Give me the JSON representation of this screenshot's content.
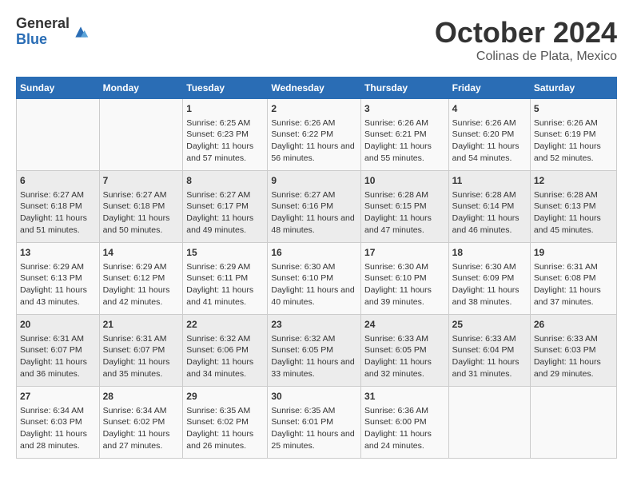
{
  "header": {
    "logo_general": "General",
    "logo_blue": "Blue",
    "month": "October 2024",
    "location": "Colinas de Plata, Mexico"
  },
  "days_of_week": [
    "Sunday",
    "Monday",
    "Tuesday",
    "Wednesday",
    "Thursday",
    "Friday",
    "Saturday"
  ],
  "weeks": [
    [
      {
        "day": "",
        "sunrise": "",
        "sunset": "",
        "daylight": ""
      },
      {
        "day": "",
        "sunrise": "",
        "sunset": "",
        "daylight": ""
      },
      {
        "day": "1",
        "sunrise": "Sunrise: 6:25 AM",
        "sunset": "Sunset: 6:23 PM",
        "daylight": "Daylight: 11 hours and 57 minutes."
      },
      {
        "day": "2",
        "sunrise": "Sunrise: 6:26 AM",
        "sunset": "Sunset: 6:22 PM",
        "daylight": "Daylight: 11 hours and 56 minutes."
      },
      {
        "day": "3",
        "sunrise": "Sunrise: 6:26 AM",
        "sunset": "Sunset: 6:21 PM",
        "daylight": "Daylight: 11 hours and 55 minutes."
      },
      {
        "day": "4",
        "sunrise": "Sunrise: 6:26 AM",
        "sunset": "Sunset: 6:20 PM",
        "daylight": "Daylight: 11 hours and 54 minutes."
      },
      {
        "day": "5",
        "sunrise": "Sunrise: 6:26 AM",
        "sunset": "Sunset: 6:19 PM",
        "daylight": "Daylight: 11 hours and 52 minutes."
      }
    ],
    [
      {
        "day": "6",
        "sunrise": "Sunrise: 6:27 AM",
        "sunset": "Sunset: 6:18 PM",
        "daylight": "Daylight: 11 hours and 51 minutes."
      },
      {
        "day": "7",
        "sunrise": "Sunrise: 6:27 AM",
        "sunset": "Sunset: 6:18 PM",
        "daylight": "Daylight: 11 hours and 50 minutes."
      },
      {
        "day": "8",
        "sunrise": "Sunrise: 6:27 AM",
        "sunset": "Sunset: 6:17 PM",
        "daylight": "Daylight: 11 hours and 49 minutes."
      },
      {
        "day": "9",
        "sunrise": "Sunrise: 6:27 AM",
        "sunset": "Sunset: 6:16 PM",
        "daylight": "Daylight: 11 hours and 48 minutes."
      },
      {
        "day": "10",
        "sunrise": "Sunrise: 6:28 AM",
        "sunset": "Sunset: 6:15 PM",
        "daylight": "Daylight: 11 hours and 47 minutes."
      },
      {
        "day": "11",
        "sunrise": "Sunrise: 6:28 AM",
        "sunset": "Sunset: 6:14 PM",
        "daylight": "Daylight: 11 hours and 46 minutes."
      },
      {
        "day": "12",
        "sunrise": "Sunrise: 6:28 AM",
        "sunset": "Sunset: 6:13 PM",
        "daylight": "Daylight: 11 hours and 45 minutes."
      }
    ],
    [
      {
        "day": "13",
        "sunrise": "Sunrise: 6:29 AM",
        "sunset": "Sunset: 6:13 PM",
        "daylight": "Daylight: 11 hours and 43 minutes."
      },
      {
        "day": "14",
        "sunrise": "Sunrise: 6:29 AM",
        "sunset": "Sunset: 6:12 PM",
        "daylight": "Daylight: 11 hours and 42 minutes."
      },
      {
        "day": "15",
        "sunrise": "Sunrise: 6:29 AM",
        "sunset": "Sunset: 6:11 PM",
        "daylight": "Daylight: 11 hours and 41 minutes."
      },
      {
        "day": "16",
        "sunrise": "Sunrise: 6:30 AM",
        "sunset": "Sunset: 6:10 PM",
        "daylight": "Daylight: 11 hours and 40 minutes."
      },
      {
        "day": "17",
        "sunrise": "Sunrise: 6:30 AM",
        "sunset": "Sunset: 6:10 PM",
        "daylight": "Daylight: 11 hours and 39 minutes."
      },
      {
        "day": "18",
        "sunrise": "Sunrise: 6:30 AM",
        "sunset": "Sunset: 6:09 PM",
        "daylight": "Daylight: 11 hours and 38 minutes."
      },
      {
        "day": "19",
        "sunrise": "Sunrise: 6:31 AM",
        "sunset": "Sunset: 6:08 PM",
        "daylight": "Daylight: 11 hours and 37 minutes."
      }
    ],
    [
      {
        "day": "20",
        "sunrise": "Sunrise: 6:31 AM",
        "sunset": "Sunset: 6:07 PM",
        "daylight": "Daylight: 11 hours and 36 minutes."
      },
      {
        "day": "21",
        "sunrise": "Sunrise: 6:31 AM",
        "sunset": "Sunset: 6:07 PM",
        "daylight": "Daylight: 11 hours and 35 minutes."
      },
      {
        "day": "22",
        "sunrise": "Sunrise: 6:32 AM",
        "sunset": "Sunset: 6:06 PM",
        "daylight": "Daylight: 11 hours and 34 minutes."
      },
      {
        "day": "23",
        "sunrise": "Sunrise: 6:32 AM",
        "sunset": "Sunset: 6:05 PM",
        "daylight": "Daylight: 11 hours and 33 minutes."
      },
      {
        "day": "24",
        "sunrise": "Sunrise: 6:33 AM",
        "sunset": "Sunset: 6:05 PM",
        "daylight": "Daylight: 11 hours and 32 minutes."
      },
      {
        "day": "25",
        "sunrise": "Sunrise: 6:33 AM",
        "sunset": "Sunset: 6:04 PM",
        "daylight": "Daylight: 11 hours and 31 minutes."
      },
      {
        "day": "26",
        "sunrise": "Sunrise: 6:33 AM",
        "sunset": "Sunset: 6:03 PM",
        "daylight": "Daylight: 11 hours and 29 minutes."
      }
    ],
    [
      {
        "day": "27",
        "sunrise": "Sunrise: 6:34 AM",
        "sunset": "Sunset: 6:03 PM",
        "daylight": "Daylight: 11 hours and 28 minutes."
      },
      {
        "day": "28",
        "sunrise": "Sunrise: 6:34 AM",
        "sunset": "Sunset: 6:02 PM",
        "daylight": "Daylight: 11 hours and 27 minutes."
      },
      {
        "day": "29",
        "sunrise": "Sunrise: 6:35 AM",
        "sunset": "Sunset: 6:02 PM",
        "daylight": "Daylight: 11 hours and 26 minutes."
      },
      {
        "day": "30",
        "sunrise": "Sunrise: 6:35 AM",
        "sunset": "Sunset: 6:01 PM",
        "daylight": "Daylight: 11 hours and 25 minutes."
      },
      {
        "day": "31",
        "sunrise": "Sunrise: 6:36 AM",
        "sunset": "Sunset: 6:00 PM",
        "daylight": "Daylight: 11 hours and 24 minutes."
      },
      {
        "day": "",
        "sunrise": "",
        "sunset": "",
        "daylight": ""
      },
      {
        "day": "",
        "sunrise": "",
        "sunset": "",
        "daylight": ""
      }
    ]
  ]
}
